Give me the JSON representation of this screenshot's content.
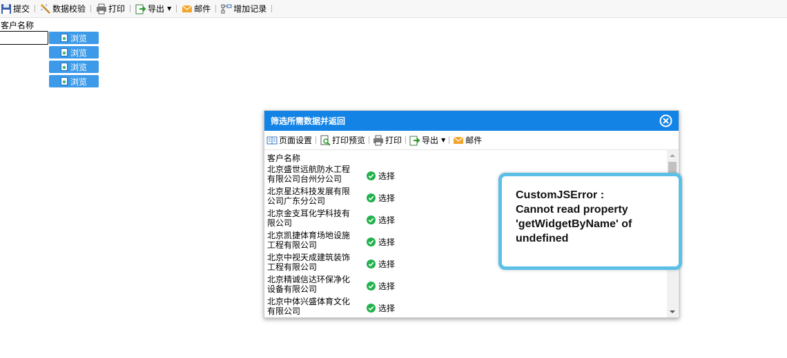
{
  "toolbar": {
    "items": [
      {
        "label": "提交",
        "icon": "save-icon"
      },
      {
        "label": "数据校验",
        "icon": "magic-wand-icon"
      },
      {
        "label": "打印",
        "icon": "printer-icon"
      },
      {
        "label": "导出",
        "icon": "export-icon",
        "has_dropdown": true
      },
      {
        "label": "邮件",
        "icon": "mail-icon"
      },
      {
        "label": "增加记录",
        "icon": "add-record-icon"
      }
    ]
  },
  "form": {
    "field_label": "客户名称",
    "customer_value": "",
    "browse_label": "浏览"
  },
  "dialog": {
    "title": "筛选所需数据并返回",
    "toolbar": {
      "page_setup": "页面设置",
      "print_preview": "打印预览",
      "print": "打印",
      "export": "导出",
      "mail": "邮件"
    },
    "column_header": "客户名称",
    "select_label": "选择",
    "rows": [
      "北京盛世远航防水工程有限公司台州分公司",
      "北京星达科技发展有限公司广东分公司",
      "北京金支耳化学科技有限公司",
      "北京凯捷体育场地设施工程有限公司",
      "北京中视天成建筑装饰工程有限公司",
      "北京精诚信达环保净化设备有限公司",
      "北京中体兴盛体育文化有限公司"
    ]
  },
  "error": {
    "message": "CustomJSError : Cannot read property 'getWidgetByName' of undefined"
  },
  "colors": {
    "dialog_header": "#1384e6",
    "browse_button": "#3c9ae8",
    "toast_border": "#5cc0e6",
    "check_green": "#22b14c"
  }
}
